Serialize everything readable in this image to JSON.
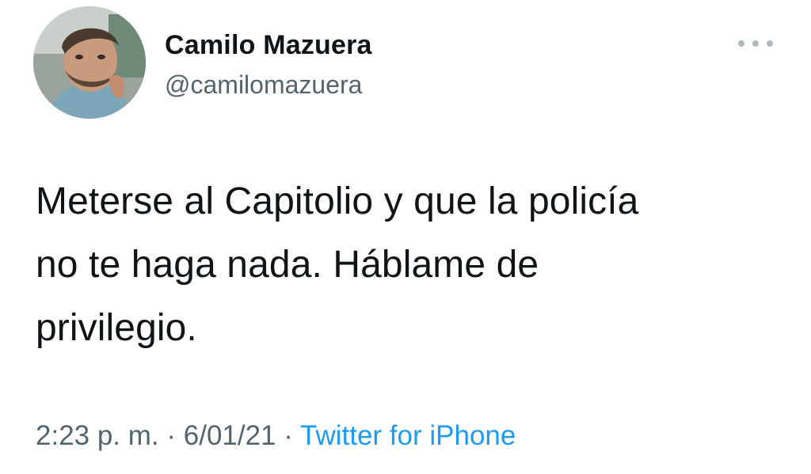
{
  "user": {
    "display_name": "Camilo Mazuera",
    "handle": "@camilomazuera"
  },
  "tweet": {
    "text": "Meterse al Capitolio y que la policía\nno te haga nada. Háblame de\nprivilegio."
  },
  "meta": {
    "time": "2:23 p. m.",
    "separator": " · ",
    "date": "6/01/21",
    "source": "Twitter for iPhone"
  },
  "icons": {
    "more": "more-options-icon",
    "avatar": "avatar"
  },
  "colors": {
    "text": "#0f1419",
    "secondary": "#536471",
    "link": "#1d9bf0"
  }
}
